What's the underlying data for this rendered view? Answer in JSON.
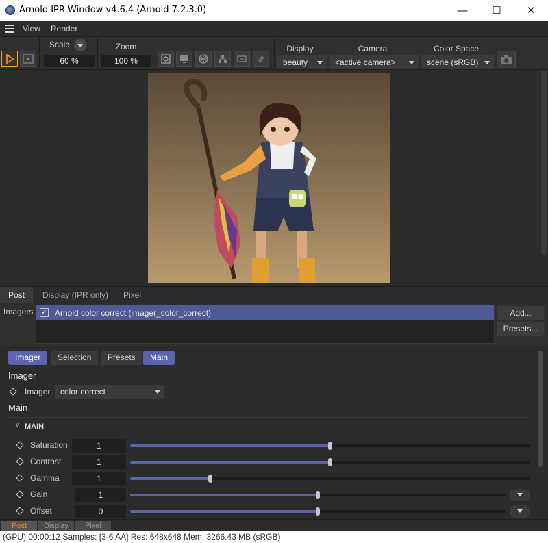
{
  "window": {
    "title": "Arnold IPR Window v4.6.4 (Arnold 7.2.3.0)"
  },
  "menu": {
    "items": [
      "View",
      "Render"
    ]
  },
  "toolbar": {
    "scale_label": "Scale",
    "scale_value": "60 %",
    "zoom_label": "Zoom",
    "zoom_value": "100 %",
    "display_label": "Display",
    "display_value": "beauty",
    "camera_label": "Camera",
    "camera_value": "<active camera>",
    "colorspace_label": "Color Space",
    "colorspace_value": "scene (sRGB)"
  },
  "tabs": [
    "Post",
    "Display (IPR only)",
    "Pixel"
  ],
  "imagers": {
    "label": "Imagers",
    "items": [
      {
        "name": "Arnold color correct (imager_color_correct)",
        "checked": true
      }
    ],
    "add_label": "Add...",
    "presets_label": "Presets..."
  },
  "params": {
    "subtabs": [
      "Imager",
      "Selection",
      "Presets",
      "Main"
    ],
    "imager_section": "Imager",
    "imager_label": "Imager",
    "imager_value": "color correct",
    "main_section": "Main",
    "group_title": "MAIN",
    "rows": [
      {
        "label": "Saturation",
        "value": "1",
        "slider": 0.5
      },
      {
        "label": "Contrast",
        "value": "1",
        "slider": 0.5
      },
      {
        "label": "Gamma",
        "value": "1",
        "slider": 0.2
      },
      {
        "label": "Gain",
        "value": "1",
        "slider": 0.5
      },
      {
        "label": "Offset",
        "value": "0",
        "slider": 0.5
      }
    ]
  },
  "bottom_tabs": [
    "Post",
    "Display",
    "Pixel"
  ],
  "status": "(GPU) 00:00:12  Samples: [3-6 AA]  Res: 648x648  Mem: 3266.43 MB  (sRGB)",
  "colors": {
    "accent": "#5b64b0",
    "active_tab": "#e08a3a",
    "play": "#f0a030"
  }
}
